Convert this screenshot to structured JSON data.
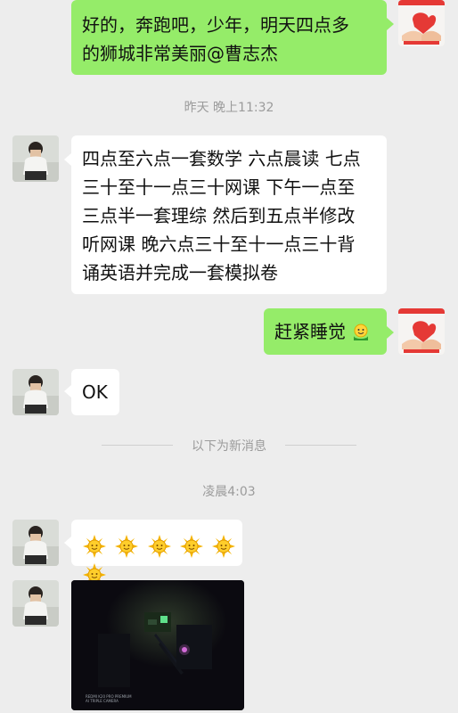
{
  "messages": {
    "m1": "好的，奔跑吧，少年，明天四点多的狮城非常美丽@曹志杰",
    "m1_line1": "好的，奔跑吧，少年，明天四点多",
    "m1_line2": "的狮城非常美丽@曹志杰",
    "time1": "昨天 晚上11:32",
    "m2_lines": [
      "四点至六点一套数学 六点晨读 七点",
      "三十至十一点三十网课 下午一点至",
      "三点半一套理综 然后到五点半修改",
      "听网课 晚六点三十至十一点三十背",
      "诵英语并完成一套模拟卷"
    ],
    "m3": "赶紧睡觉",
    "m4": "OK",
    "divider": "以下为新消息",
    "time2": "凌晨4:03",
    "photo_caption_line1": "REDMI K20 PRO PREMIUM",
    "photo_caption_line2": "AI TRIPLE CAMERA"
  },
  "icons": {
    "avatar_other": "person-avatar-icon",
    "avatar_self": "gift-hands-avatar-icon",
    "sun_emoji": "sun-emoji-icon",
    "smile_emoji": "smiling-face-emoji-icon"
  },
  "colors": {
    "background": "#ededed",
    "bubble_in": "#ffffff",
    "bubble_out": "#95ec69",
    "timestamp": "#9b9b9b"
  }
}
